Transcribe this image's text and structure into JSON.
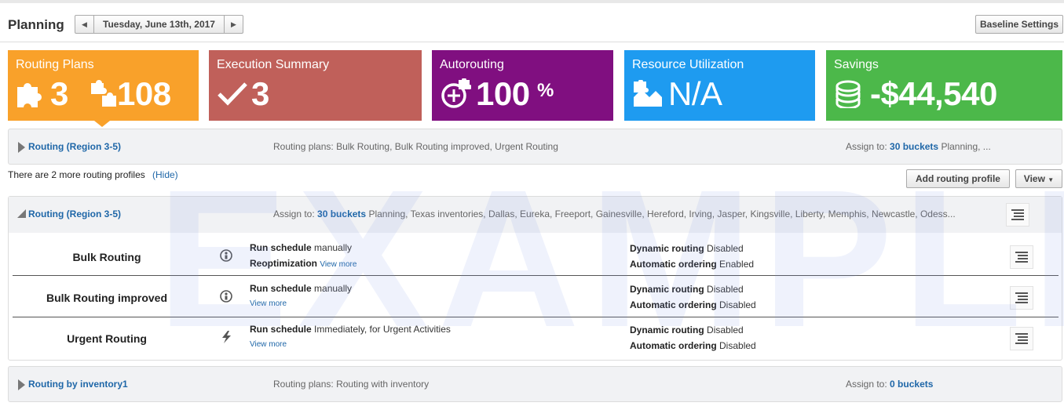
{
  "header": {
    "title": "Planning",
    "date": "Tuesday, June 13th, 2017",
    "baseline_btn": "Baseline Settings"
  },
  "tiles": {
    "routing_plans": {
      "label": "Routing Plans",
      "v1": "3",
      "v2": "108",
      "color": "#f9a12a"
    },
    "execution": {
      "label": "Execution Summary",
      "v1": "3",
      "color": "#c0605a"
    },
    "autorouting": {
      "label": "Autorouting",
      "v1": "100",
      "unit": "%",
      "color": "#800f80"
    },
    "resource": {
      "label": "Resource Utilization",
      "v1": "N/A",
      "color": "#1e9bf0"
    },
    "savings": {
      "label": "Savings",
      "v1": "-$44,540",
      "color": "#4cb84a"
    }
  },
  "profile1": {
    "name": "Routing (Region 3-5)",
    "plans_label": "Routing plans:",
    "plans": "Bulk Routing, Bulk Routing improved, Urgent Routing",
    "assign_label": "Assign to:",
    "buckets": "30 buckets",
    "assign_rest": "Planning, ..."
  },
  "more": {
    "text": "There are 2 more routing profiles",
    "hide": "(Hide)",
    "add_btn": "Add routing profile",
    "view_btn": "View"
  },
  "profile2": {
    "name": "Routing (Region 3-5)",
    "assign_label": "Assign to:",
    "buckets": "30 buckets",
    "assign_rest": "Planning, Texas inventories, Dallas, Eureka, Freeport, Gainesville, Hereford, Irving, Jasper, Kingsville, Liberty, Memphis, Newcastle, Odess..."
  },
  "plans": [
    {
      "name": "Bulk Routing",
      "sched_label": "Run schedule",
      "sched": "manually",
      "line2_bold": "Reoptimization",
      "view_more": "View more",
      "dyn_label": "Dynamic routing",
      "dyn": "Disabled",
      "ord_label": "Automatic ordering",
      "ord": "Enabled"
    },
    {
      "name": "Bulk Routing improved",
      "sched_label": "Run schedule",
      "sched": "manually",
      "view_more": "View more",
      "dyn_label": "Dynamic routing",
      "dyn": "Disabled",
      "ord_label": "Automatic ordering",
      "ord": "Disabled"
    },
    {
      "name": "Urgent Routing",
      "sched_label": "Run schedule",
      "sched": "Immediately, for Urgent Activities",
      "view_more": "View more",
      "dyn_label": "Dynamic routing",
      "dyn": "Disabled",
      "ord_label": "Automatic ordering",
      "ord": "Disabled"
    }
  ],
  "profile3": {
    "name": "Routing by inventory1",
    "plans_label": "Routing plans:",
    "plans": "Routing with inventory",
    "assign_label": "Assign to:",
    "buckets": "0 buckets"
  },
  "watermark": "EXAMPLE"
}
